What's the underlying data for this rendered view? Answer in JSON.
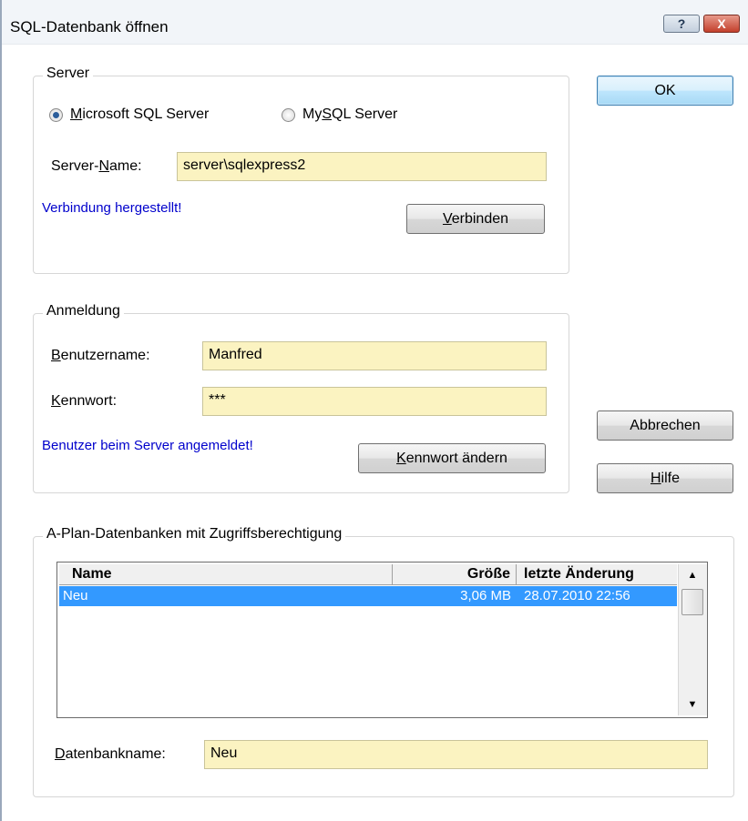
{
  "window": {
    "title": "SQL-Datenbank öffnen",
    "help_button": "?",
    "close_button": "X"
  },
  "server_group": {
    "legend": "Server",
    "radio_mssql": {
      "prefix": "",
      "accel": "M",
      "rest": "icrosoft SQL Server",
      "checked": true
    },
    "radio_mysql": {
      "prefix": "My",
      "accel": "S",
      "rest": "QL Server",
      "checked": false
    },
    "server_name_label": {
      "prefix": "Server-",
      "accel": "N",
      "rest": "ame:"
    },
    "server_name_value": "server\\sqlexpress2",
    "status": "Verbindung hergestellt!",
    "connect_button": {
      "accel": "V",
      "rest": "erbinden"
    }
  },
  "login_group": {
    "legend": "Anmeldung",
    "username_label": {
      "accel": "B",
      "rest": "enutzername:"
    },
    "username_value": "Manfred",
    "password_label": {
      "accel": "K",
      "rest": "ennwort:"
    },
    "password_value": "***",
    "status": "Benutzer beim Server angemeldet!",
    "change_password_button": {
      "accel": "K",
      "rest": "ennwort ändern"
    }
  },
  "db_group": {
    "legend": "A-Plan-Datenbanken mit Zugriffsberechtigung",
    "columns": [
      "Name",
      "Größe",
      "letzte Änderung"
    ],
    "rows": [
      {
        "name": "Neu",
        "size": "3,06 MB",
        "modified": "28.07.2010 22:56",
        "selected": true
      }
    ],
    "dbname_label": {
      "accel": "D",
      "rest": "atenbankname:"
    },
    "dbname_value": "Neu"
  },
  "buttons": {
    "ok": "OK",
    "cancel": "Abbrechen",
    "help": {
      "accel": "H",
      "rest": "ilfe"
    }
  },
  "icons": {
    "scroll_up": "▲",
    "scroll_down": "▼"
  }
}
